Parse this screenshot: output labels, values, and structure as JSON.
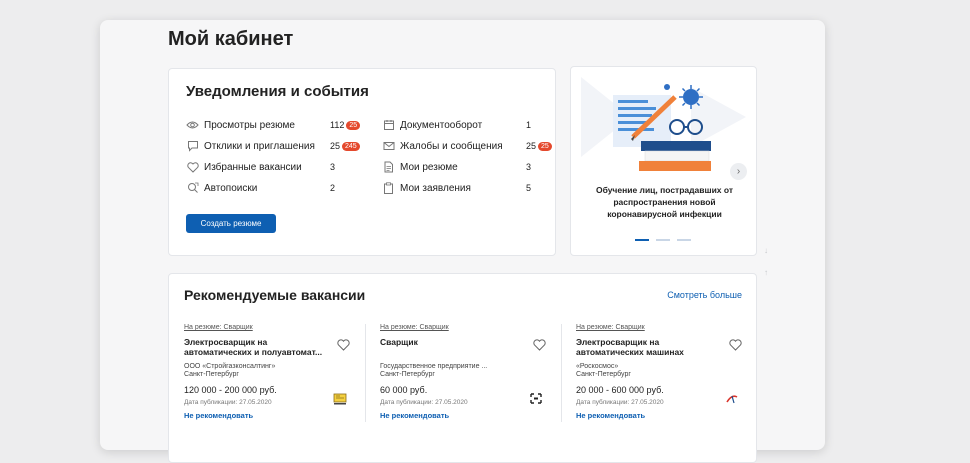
{
  "page": {
    "title": "Мой кабинет"
  },
  "notifications": {
    "title": "Уведомления и события",
    "left": [
      {
        "label": "Просмотры резюме",
        "count": "112",
        "badge": "25",
        "icon": "eye-icon"
      },
      {
        "label": "Отклики и приглашения",
        "count": "25",
        "badge": "245",
        "icon": "chat-icon"
      },
      {
        "label": "Избранные вакансии",
        "count": "3",
        "badge": "",
        "icon": "heart-icon"
      },
      {
        "label": "Автопоиски",
        "count": "2",
        "badge": "",
        "icon": "autosearch-icon"
      }
    ],
    "right": [
      {
        "label": "Документооборот",
        "count": "1",
        "badge": "",
        "icon": "calendar-icon"
      },
      {
        "label": "Жалобы и сообщения",
        "count": "25",
        "badge": "25",
        "icon": "mail-icon"
      },
      {
        "label": "Мои резюме",
        "count": "3",
        "badge": "",
        "icon": "document-icon"
      },
      {
        "label": "Мои заявления",
        "count": "5",
        "badge": "",
        "icon": "clipboard-icon"
      }
    ],
    "create_button": "Создать резюме"
  },
  "promo": {
    "text": "Обучение лиц, пострадавших от распространения новой коронавирусной инфекции",
    "active_slide": 1,
    "slides": 3
  },
  "recommended": {
    "title": "Рекомендуемые вакансии",
    "see_more": "Смотреть больше",
    "vacancies": [
      {
        "from_resume": "На резюме: Сварщик",
        "title": "Электросварщик на автоматических и полуавтомат...",
        "company": "ООО «Стройгазконсалтинг»",
        "city": "Санкт-Петербург",
        "salary": "120 000 - 200 000 руб.",
        "published": "Дата публикации: 27.05.2020",
        "not_recommend": "Не рекомендовать"
      },
      {
        "from_resume": "На резюме: Сварщик",
        "title": "Сварщик",
        "company": "Государственное предприятие ...",
        "city": "Санкт-Петербург",
        "salary": "60 000 руб.",
        "published": "Дата публикации: 27.05.2020",
        "not_recommend": "Не рекомендовать"
      },
      {
        "from_resume": "На резюме: Сварщик",
        "title": "Электросварщик на автоматических машинах",
        "company": "«Роскосмос»",
        "city": "Санкт-Петербург",
        "salary": "20 000 - 600 000 руб.",
        "published": "Дата публикации: 27.05.2020",
        "not_recommend": "Не рекомендовать"
      }
    ]
  },
  "colors": {
    "accent": "#0e5fb2",
    "badge": "#e4492d"
  }
}
